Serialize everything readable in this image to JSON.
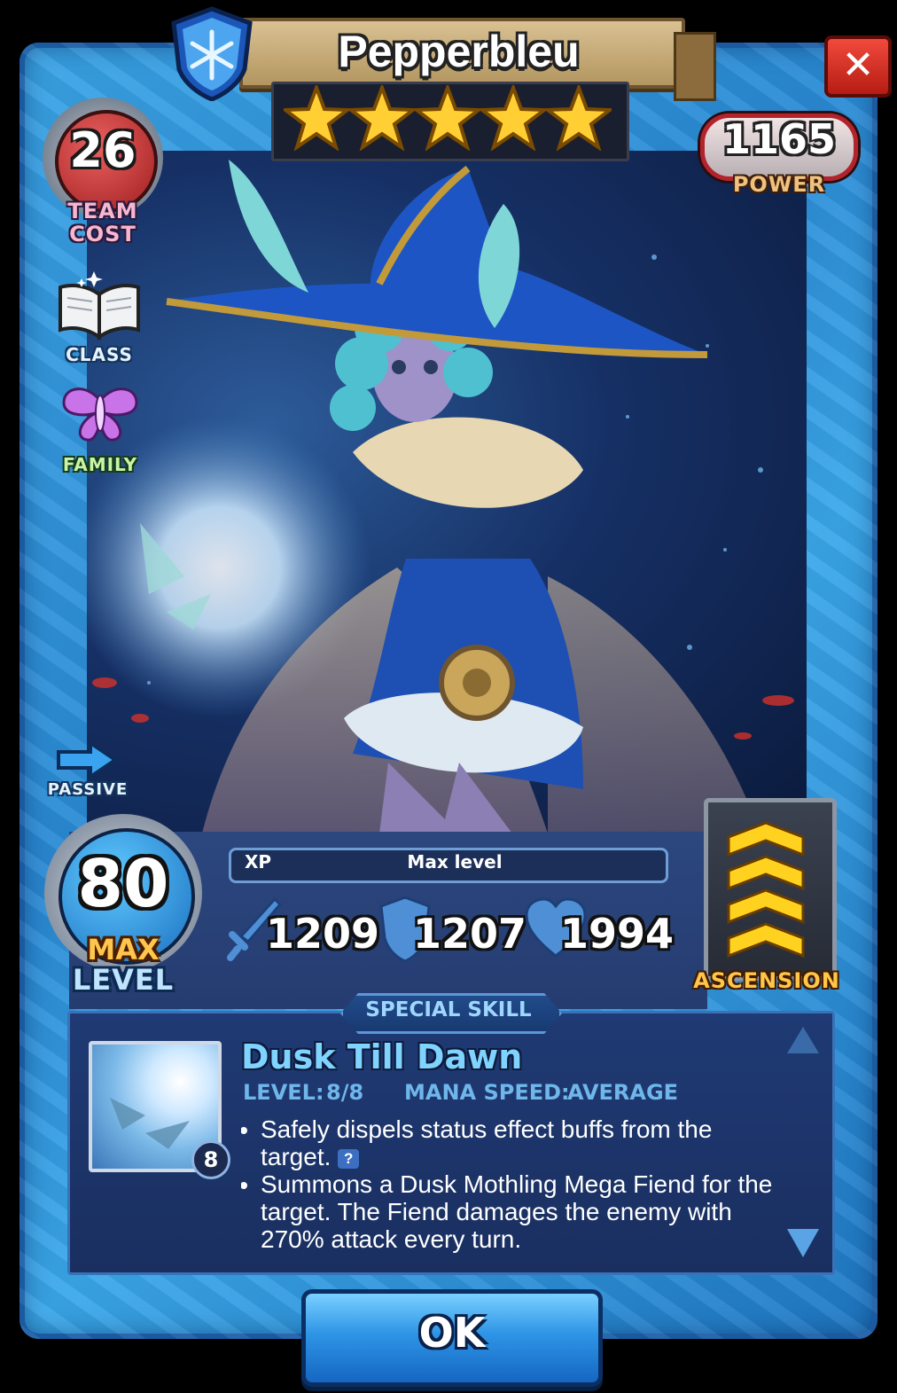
{
  "hero": {
    "name": "Pepperbleu",
    "stars": 5,
    "element_icon": "snowflake-shield-icon",
    "team_cost": "26",
    "team_cost_label_line1": "TEAM",
    "team_cost_label_line2": "COST",
    "power": "1165",
    "power_label": "POWER",
    "class_label": "CLASS",
    "family_label": "FAMILY",
    "passive_label": "PASSIVE"
  },
  "level": {
    "value": "80",
    "max_label": "MAX",
    "level_label": "LEVEL",
    "xp_label": "XP",
    "xp_status": "Max level"
  },
  "stats": {
    "attack": "1209",
    "defense": "1207",
    "health": "1994"
  },
  "ascension": {
    "label": "ASCENSION",
    "chevrons": 4
  },
  "skill": {
    "section_label": "SPECIAL SKILL",
    "name": "Dusk Till Dawn",
    "level_label": "LEVEL:",
    "level_value": "8/8",
    "mana_label": "MANA SPEED:",
    "mana_value": "AVERAGE",
    "badge": "8",
    "bullets": [
      "Safely dispels status effect buffs from the target.",
      "Summons a Dusk Mothling Mega Fiend for the target. The Fiend damages the enemy with 270% attack every turn."
    ],
    "help_glyph": "?"
  },
  "buttons": {
    "ok_label": "OK",
    "close_glyph": "✕"
  },
  "colors": {
    "frame_blue": "#2a8ad4",
    "power_red": "#b4232b",
    "ascension_gold": "#ffc64a",
    "skill_name": "#7fd3ff"
  }
}
